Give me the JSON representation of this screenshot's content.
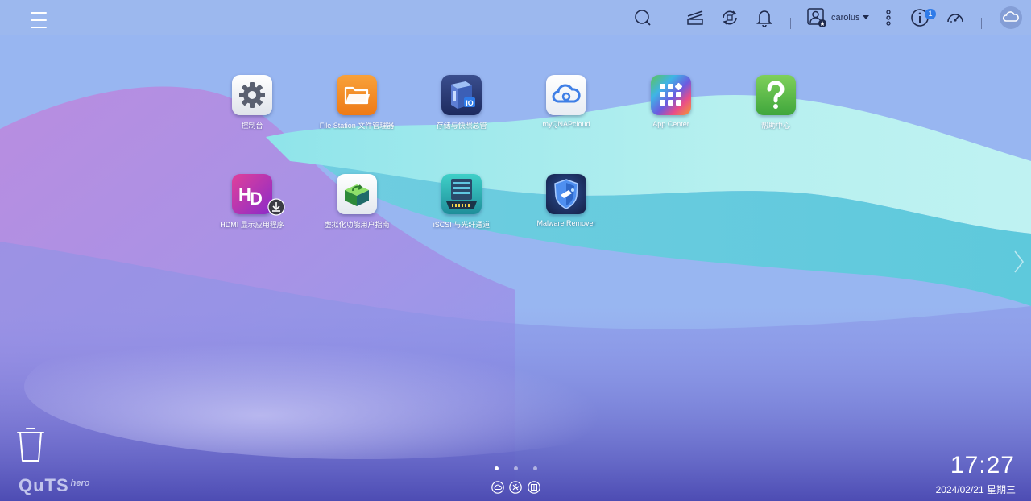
{
  "topbar": {
    "username": "carolus",
    "notification_count": "1"
  },
  "icons": {
    "menu": "hamburger-icon",
    "search": "search-icon",
    "tasks": "background-tasks-icon",
    "sync": "sync-icon",
    "notifications": "bell-icon",
    "user": "user-icon",
    "more": "more-vertical-icon",
    "info": "info-icon",
    "dashboard": "gauge-icon",
    "cloud": "cloud-icon",
    "trash": "trash-icon"
  },
  "apps": [
    {
      "label": "控制台",
      "icon": "settings-gear-icon"
    },
    {
      "label": "File Station 文件管理器",
      "icon": "folder-icon"
    },
    {
      "label": "存储与快照总管",
      "icon": "storage-snapshot-icon"
    },
    {
      "label": "myQNAPcloud",
      "icon": "cloud-app-icon"
    },
    {
      "label": "App Center",
      "icon": "app-grid-icon"
    },
    {
      "label": "帮助中心",
      "icon": "help-question-icon"
    },
    {
      "label": "HDMI 显示应用程序",
      "icon": "hdmi-display-icon"
    },
    {
      "label": "虚拟化功能用户指南",
      "icon": "virtualization-box-icon"
    },
    {
      "label": "iSCSI 与光纤通道",
      "icon": "iscsi-server-icon"
    },
    {
      "label": "Malware Remover",
      "icon": "shield-icon"
    }
  ],
  "pages": {
    "count": 3,
    "active": 0
  },
  "brand": {
    "main": "QuTS",
    "sub": "hero"
  },
  "clock": {
    "time": "17:27",
    "date": "2024/02/21 星期三"
  },
  "colors": {
    "accent": "#2f7be8",
    "topbar_text": "#1f2a4d"
  }
}
